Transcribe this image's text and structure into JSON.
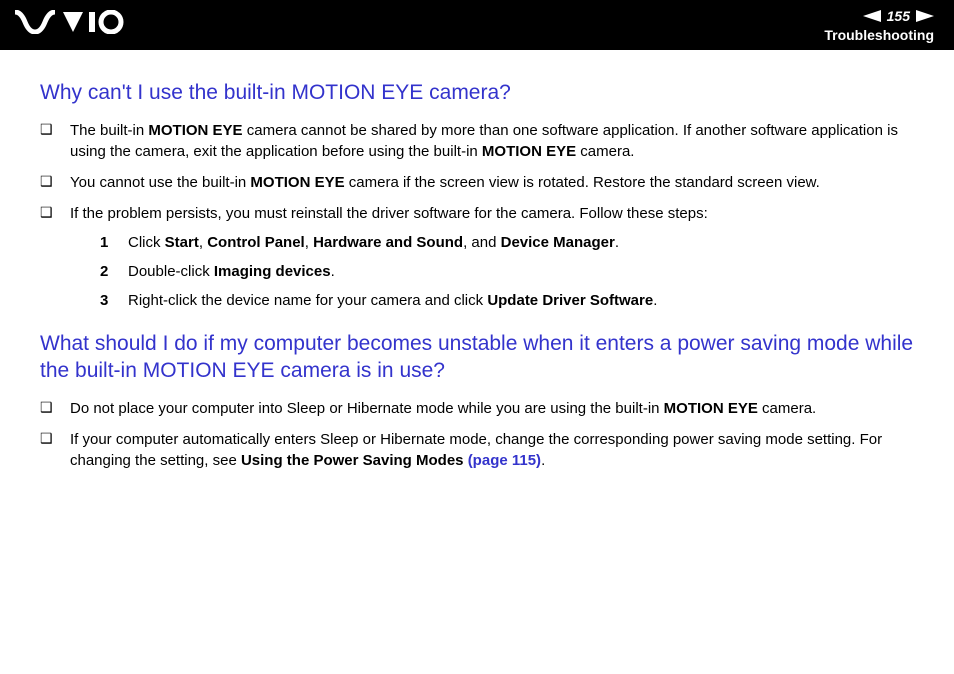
{
  "header": {
    "logo_text": "VAIO",
    "page_number": "155",
    "section": "Troubleshooting"
  },
  "section1": {
    "heading": "Why can't I use the built-in MOTION EYE camera?",
    "bullets": [
      {
        "pre": "The built-in ",
        "b1": "MOTION EYE",
        "mid": " camera cannot be shared by more than one software application. If another software application is using the camera, exit the application before using the built-in ",
        "b2": "MOTION EYE",
        "post": " camera."
      },
      {
        "pre": "You cannot use the built-in ",
        "b1": "MOTION EYE",
        "mid": " camera if the screen view is rotated. Restore the standard screen view.",
        "b2": "",
        "post": ""
      },
      {
        "pre": "If the problem persists, you must reinstall the driver software for the camera. Follow these steps:",
        "b1": "",
        "mid": "",
        "b2": "",
        "post": ""
      }
    ],
    "steps": [
      {
        "num": "1",
        "t0": "Click ",
        "b0": "Start",
        "t1": ", ",
        "b1": "Control Panel",
        "t2": ", ",
        "b2": "Hardware and Sound",
        "t3": ", and ",
        "b3": "Device Manager",
        "t4": "."
      },
      {
        "num": "2",
        "t0": "Double-click ",
        "b0": "Imaging devices",
        "t1": ".",
        "b1": "",
        "t2": "",
        "b2": "",
        "t3": "",
        "b3": "",
        "t4": ""
      },
      {
        "num": "3",
        "t0": "Right-click the device name for your camera and click ",
        "b0": "Update Driver Software",
        "t1": ".",
        "b1": "",
        "t2": "",
        "b2": "",
        "t3": "",
        "b3": "",
        "t4": ""
      }
    ]
  },
  "section2": {
    "heading": "What should I do if my computer becomes unstable when it enters a power saving mode while the built-in MOTION EYE camera is in use?",
    "bullets": [
      {
        "pre": "Do not place your computer into Sleep or Hibernate mode while you are using the built-in ",
        "b1": "MOTION EYE",
        "post": " camera."
      },
      {
        "pre": "If your computer automatically enters Sleep or Hibernate mode, change the corresponding power saving mode setting. For changing the setting, see ",
        "b1": "Using the Power Saving Modes ",
        "link": "(page 115)",
        "post": "."
      }
    ]
  }
}
